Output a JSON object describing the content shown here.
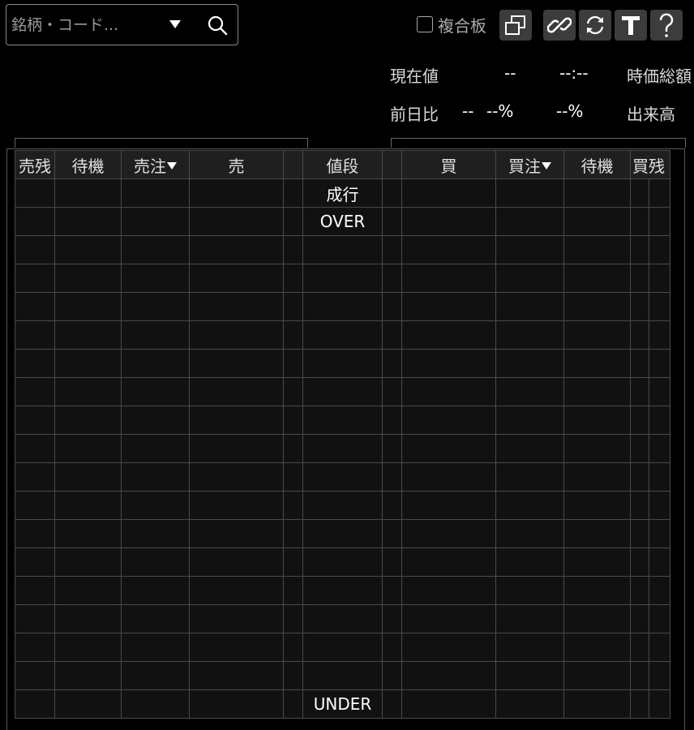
{
  "search": {
    "placeholder": "銘柄・コード..."
  },
  "toolbar": {
    "combined_board_label": "複合板",
    "buttons": [
      "window-icon",
      "link-icon",
      "refresh-icon",
      "text-icon",
      "help-icon"
    ]
  },
  "info": {
    "current_price_label": "現在値",
    "current_price_value": "--",
    "time_value": "--:--",
    "market_cap_label": "時価総額",
    "prev_day_label": "前日比",
    "change_value": "--",
    "change_pct": "--%",
    "change_pct2": "--%",
    "volume_label": "出来高"
  },
  "board": {
    "headers": [
      "売残",
      "待機",
      "売注",
      "売",
      "",
      "値段",
      "",
      "買",
      "買注",
      "待機",
      "買残",
      ""
    ],
    "price_column": [
      "成行",
      "OVER",
      "",
      "",
      "",
      "",
      "",
      "",
      "",
      "",
      "",
      "",
      "",
      "",
      "",
      "",
      "",
      "",
      "UNDER"
    ]
  },
  "colors": {
    "background": "#000000",
    "grid": "#4a4a4a",
    "button": "#3c3c3c"
  }
}
